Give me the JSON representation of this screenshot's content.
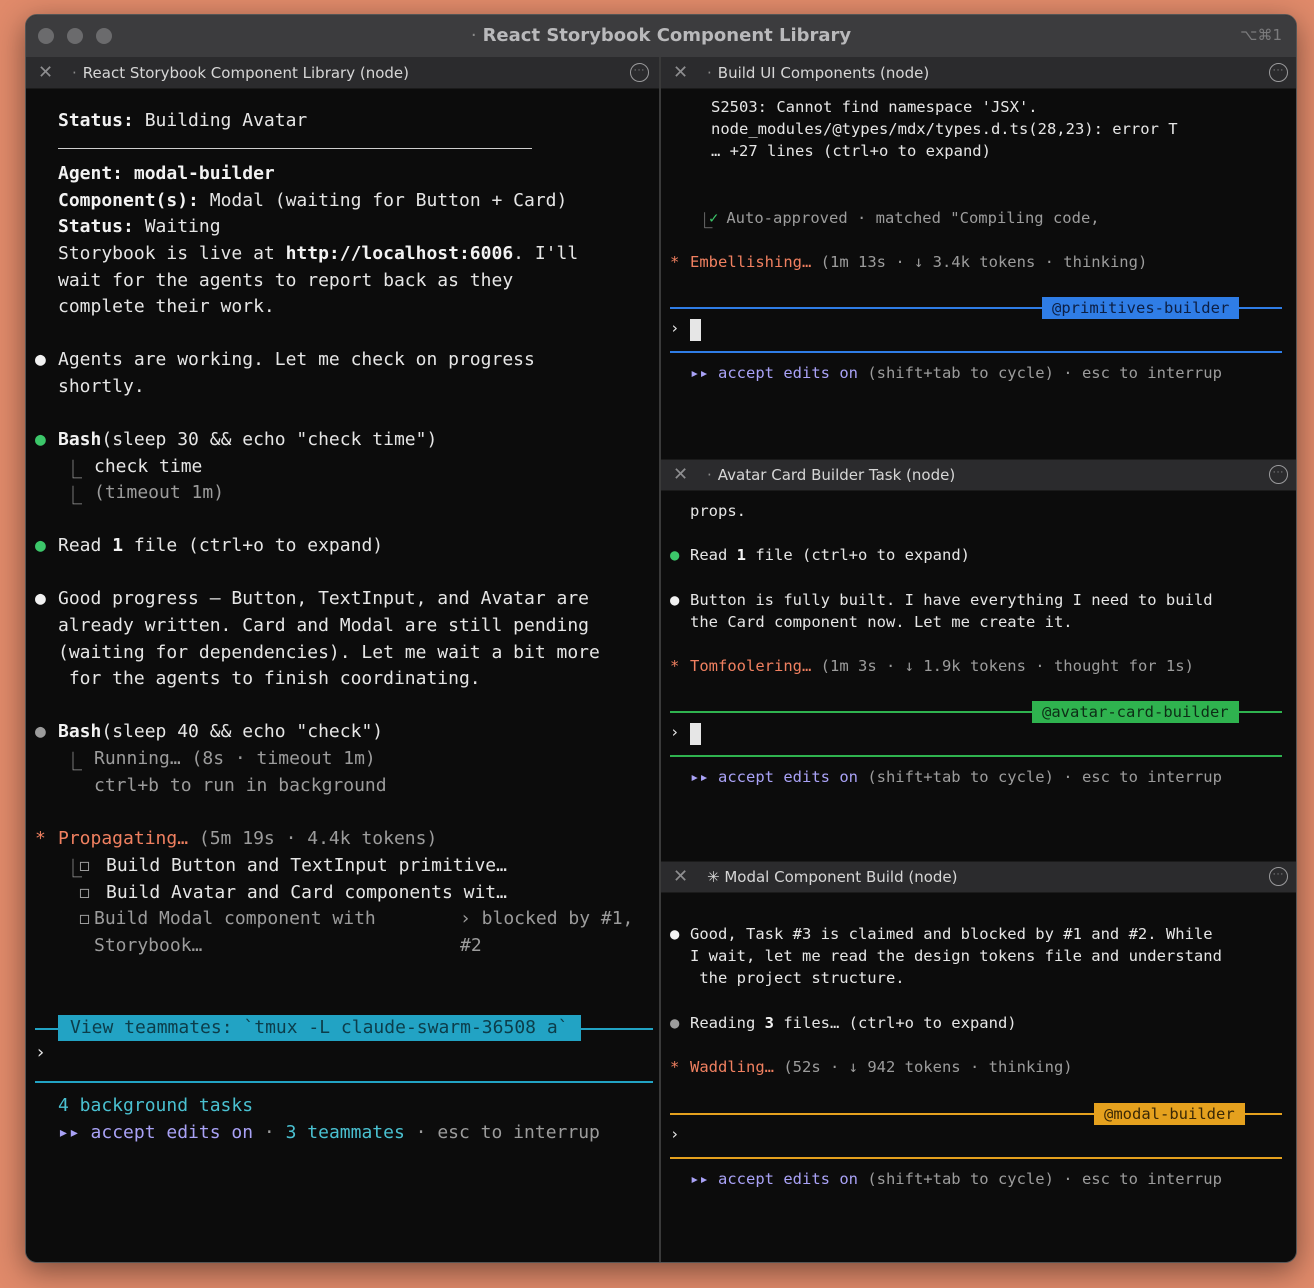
{
  "window": {
    "title": "React Storybook Component Library",
    "shortcut": "⌥⌘1"
  },
  "left_pane": {
    "title": "React Storybook Component Library (node)",
    "status1_label": "Status:",
    "status1_value": " Building Avatar",
    "agent_label": "Agent:",
    "agent_value": " modal-builder",
    "components_label": "Component(s):",
    "components_value": " Modal (waiting for Button + Card)",
    "status2_label": "Status:",
    "status2_value": " Waiting",
    "live_prefix": "Storybook is live at ",
    "live_url": "http://localhost:6006",
    "live_suffix": ". I'll",
    "live_line2": "wait for the agents to report back as they",
    "live_line3": "complete their work.",
    "msg1_line1": "Agents are working. Let me check on progress",
    "msg1_line2": "shortly.",
    "bash1_cmd": "Bash",
    "bash1_args": "(sleep 30 && echo \"check time\")",
    "bash1_out1": "check time",
    "bash1_out2": "(timeout 1m)",
    "read1_prefix": "Read ",
    "read1_count": "1",
    "read1_suffix": " file (ctrl+o to expand)",
    "msg2_line1": "Good progress — Button, TextInput, and Avatar are",
    "msg2_line2": "already written. Card and Modal are still pending",
    "msg2_line3": "(waiting for dependencies). Let me wait a bit more",
    "msg2_line4": " for the agents to finish coordinating.",
    "bash2_cmd": "Bash",
    "bash2_args": "(sleep 40 && echo \"check\")",
    "bash2_out1": "Running… (8s · timeout 1m)",
    "bash2_out2": "ctrl+b to run in background",
    "prop_label": "Propagating…",
    "prop_stats": " (5m 19s · 4.4k tokens)",
    "task1": "Build Button and TextInput primitive…",
    "task2": "Build Avatar and Card components wit…",
    "task3a": "Build Modal component with",
    "task3b": "Storybook…",
    "task3_blocked_a": "› blocked by #1,",
    "task3_blocked_b": "#2",
    "banner": "View teammates: `tmux -L claude-swarm-36508 a`",
    "prompt": "›",
    "bg_tasks": "4 background tasks",
    "footer_arrow": "▸▸",
    "footer_accept": " accept edits on",
    "footer_sep1": " · ",
    "footer_teammates": "3 teammates",
    "footer_sep2": " · esc to interrup"
  },
  "pane_ui": {
    "title": "Build UI Components (node)",
    "line1": "S2503: Cannot find namespace 'JSX'.",
    "line2": "node_modules/@types/mdx/types.d.ts(28,23): error T",
    "line3": "… +27 lines (ctrl+o to expand)",
    "approved_check": "✓",
    "approved_text": " Auto-approved · matched \"Compiling code,",
    "status_label": "Embellishing…",
    "status_stats": " (1m 13s · ↓ 3.4k tokens · thinking)",
    "tag": "@primitives-builder",
    "tag_color": "#2f7de6",
    "prompt": "›",
    "footer_arrow": "▸▸",
    "footer_accept": " accept edits on",
    "footer_rest": " (shift+tab to cycle) · esc to interrup"
  },
  "pane_avatar": {
    "title": "Avatar Card Builder Task (node)",
    "line0": "props.",
    "read_prefix": "Read ",
    "read_count": "1",
    "read_suffix": " file (ctrl+o to expand)",
    "msg_line1": "Button is fully built. I have everything I need to build",
    "msg_line2": "the Card component now. Let me create it.",
    "status_label": "Tomfoolering…",
    "status_stats": " (1m 3s · ↓ 1.9k tokens · thought for 1s)",
    "tag": "@avatar-card-builder",
    "tag_color": "#2fb34f",
    "prompt": "›",
    "footer_arrow": "▸▸",
    "footer_accept": " accept edits on",
    "footer_rest": " (shift+tab to cycle) · esc to interrup"
  },
  "pane_modal": {
    "title": "✳ Modal Component Build (node)",
    "msg_line1": "Good, Task #3 is claimed and blocked by #1 and #2. While",
    "msg_line2": "I wait, let me read the design tokens file and understand",
    "msg_line3": " the project structure.",
    "read_prefix": "Reading ",
    "read_count": "3",
    "read_suffix": " files… (ctrl+o to expand)",
    "status_label": "Waddling…",
    "status_stats": " (52s · ↓ 942 tokens · thinking)",
    "tag": "@modal-builder",
    "tag_color": "#e5a11e",
    "prompt": "›",
    "footer_arrow": "▸▸",
    "footer_accept": " accept edits on",
    "footer_rest": " (shift+tab to cycle) · esc to interrup"
  },
  "colors": {
    "background": "#e08a6a",
    "terminal": "#0c0c0c",
    "accent_purple": "#a9a2f6",
    "status_salmon": "#f08060",
    "bullet_green": "#3cc76a",
    "banner_cyan": "#22a3c4"
  }
}
